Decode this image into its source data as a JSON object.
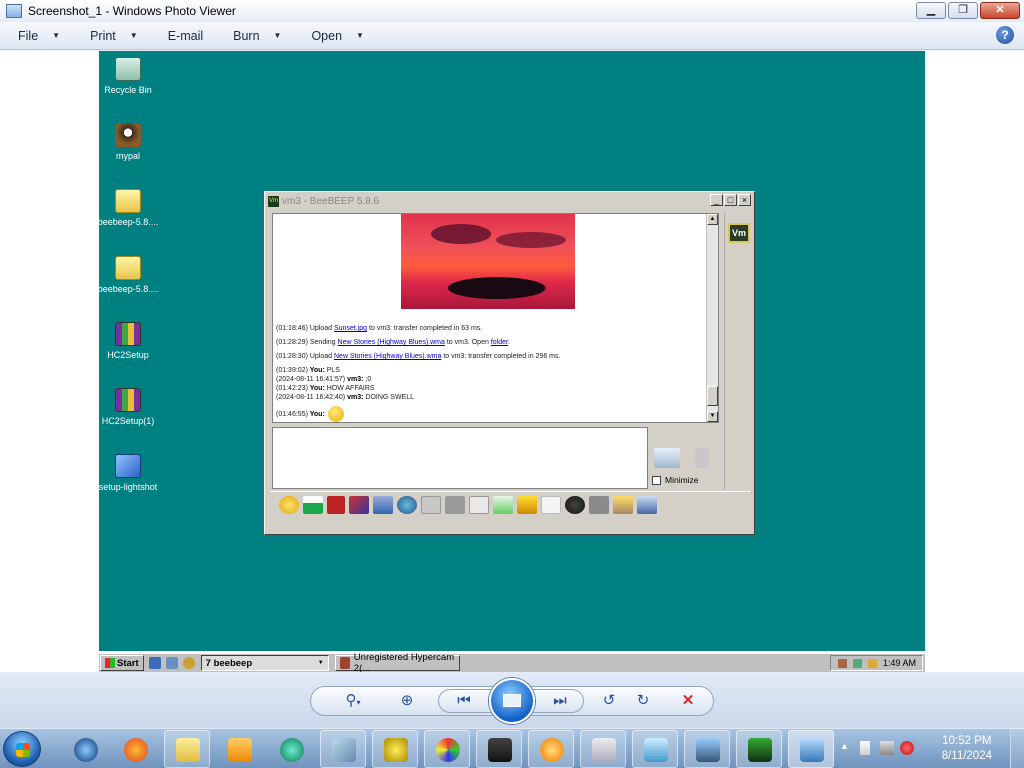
{
  "window": {
    "title": "Screenshot_1 - Windows Photo Viewer",
    "controls": {
      "minimize": "▁",
      "restore": "❐",
      "close": "✕"
    }
  },
  "menu": [
    {
      "label": "File",
      "has_arrow": true
    },
    {
      "label": "Print",
      "has_arrow": true
    },
    {
      "label": "E-mail",
      "has_arrow": false
    },
    {
      "label": "Burn",
      "has_arrow": true
    },
    {
      "label": "Open",
      "has_arrow": true
    }
  ],
  "help": "?",
  "desktop": {
    "background": "#008080",
    "icons": [
      {
        "label": "Recycle Bin",
        "icon": "recycle-bin-icon"
      },
      {
        "label": "mypal",
        "icon": "mypal-icon"
      },
      {
        "label": "beebeep-5.8....",
        "icon": "zip-folder-icon"
      },
      {
        "label": "beebeep-5.8....",
        "icon": "folder-icon"
      },
      {
        "label": "HC2Setup",
        "icon": "installer-icon"
      },
      {
        "label": "HC2Setup(1)",
        "icon": "installer-icon"
      },
      {
        "label": "setup-lightshot",
        "icon": "setup-icon"
      }
    ],
    "taskbar": {
      "start": "Start",
      "task1": "7 beebeep",
      "task2": "Unregistered Hypercam 2(...",
      "time": "1:49 AM"
    }
  },
  "beebeep": {
    "title": "vm3 - BeeBEEP 5.8.6",
    "badge": "Vm",
    "log": [
      {
        "time": "(01:18:46)",
        "pre": " Upload ",
        "link": "Sunset.jpg",
        "post": " to vm3: transfer completed in 63 ms.",
        "bold": ""
      },
      {
        "time": "(01:28:29)",
        "pre": " Sending ",
        "link": "New Stories (Highway Blues).wma",
        "post": " to vm3. Open ",
        "link2": "folder",
        "end": ".",
        "bold": ""
      },
      {
        "time": "(01:28:30)",
        "pre": " Upload ",
        "link": "New Stories (Highway Blues).wma",
        "post": " to vm3: transfer completed in 296 ms.",
        "bold": ""
      },
      {
        "time": "(01:39:02)",
        "bold": " You:",
        "text": " PLS"
      },
      {
        "time": "(2024-08-11 16:41:57)",
        "bold": " vm3:",
        "text": " ;0"
      },
      {
        "time": "(01:42:23)",
        "bold": " You:",
        "text": " HOW AFFAIRS"
      },
      {
        "time": "(2024-08-11 16:42:40)",
        "bold": " vm3:",
        "text": " DOING SWELL"
      },
      {
        "time": "(01:46:55)",
        "bold": " You:",
        "text": ""
      }
    ],
    "input_value": "",
    "minimize_label": "Minimize"
  },
  "viewer_controls": {
    "zoom": "⚲",
    "fit": "⊕",
    "prev": "⏮",
    "next": "⏭",
    "rotate_ccw": "↺",
    "rotate_cw": "↻",
    "delete": "✕"
  },
  "taskbar": {
    "time": "10:52 PM",
    "date": "8/11/2024"
  }
}
